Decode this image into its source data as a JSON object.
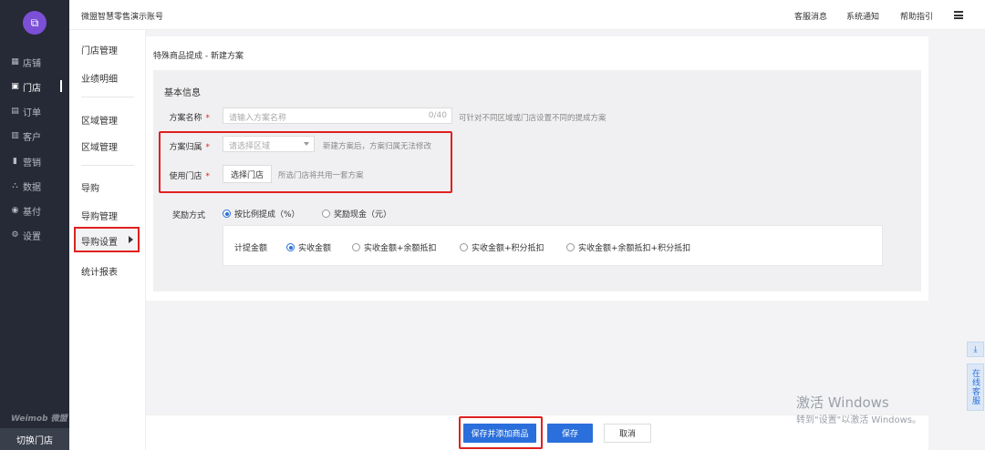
{
  "sidebar": {
    "items": [
      {
        "icon": "store-icon",
        "glyph": "▦",
        "label": "店铺"
      },
      {
        "icon": "shop-icon",
        "glyph": "▣",
        "label": "门店"
      },
      {
        "icon": "order-icon",
        "glyph": "▤",
        "label": "订单"
      },
      {
        "icon": "customer-icon",
        "glyph": "▥",
        "label": "客户"
      },
      {
        "icon": "marketing-icon",
        "glyph": "▮",
        "label": "营销"
      },
      {
        "icon": "data-icon",
        "glyph": "⛬",
        "label": "数据"
      },
      {
        "icon": "payment-icon",
        "glyph": "◉",
        "label": "基付"
      },
      {
        "icon": "settings-icon",
        "glyph": "⚙",
        "label": "设置"
      }
    ],
    "brand": "Weimob 微盟",
    "switch_store": "切换门店"
  },
  "topbar": {
    "account": "微盟智慧零售演示账号",
    "links": [
      "客服消息",
      "系统通知",
      "帮助指引"
    ]
  },
  "subnav": {
    "items": [
      "门店管理",
      "业绩明细",
      "区域管理",
      "区域管理",
      "导购",
      "导购管理",
      "导购设置",
      "统计报表"
    ]
  },
  "breadcrumb": "特殊商品提成 - 新建方案",
  "form": {
    "section_title": "基本信息",
    "plan_name": {
      "label": "方案名称",
      "placeholder": "请输入方案名称",
      "counter": "0/40",
      "hint": "可针对不同区域或门店设置不同的提成方案"
    },
    "plan_region": {
      "label": "方案归属",
      "placeholder": "请选择区域",
      "hint": "新建方案后，方案归属无法修改"
    },
    "stores": {
      "label": "使用门店",
      "button": "选择门店",
      "hint": "所选门店将共用一套方案"
    },
    "reward": {
      "label": "奖励方式",
      "options": [
        "按比例提成（%）",
        "奖励现金（元）"
      ],
      "selected": 0
    },
    "base_amount": {
      "label": "计提金额",
      "options": [
        "实收金额",
        "实收金额+余额抵扣",
        "实收金额+积分抵扣",
        "实收金额+余额抵扣+积分抵扣"
      ],
      "selected": 0
    }
  },
  "footer": {
    "save_add": "保存并添加商品",
    "save": "保存",
    "cancel": "取消"
  },
  "float": {
    "download": "⤓",
    "service": "在线客服"
  },
  "watermark": {
    "line1": "激活 Windows",
    "line2": "转到\"设置\"以激活 Windows。"
  },
  "colors": {
    "accent": "#2a6fdb",
    "highlight": "#e02020",
    "sidebar": "#262a36"
  }
}
